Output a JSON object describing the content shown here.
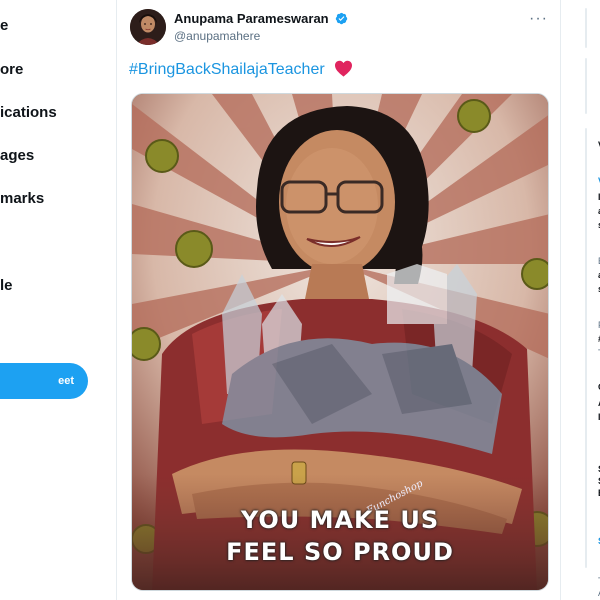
{
  "nav": {
    "items": [
      {
        "label": "e"
      },
      {
        "label": "ore"
      },
      {
        "label": "ications"
      },
      {
        "label": "ages"
      },
      {
        "label": "marks"
      },
      {
        "label": "le"
      }
    ],
    "tweet_button": "eet"
  },
  "tweet": {
    "author_name": "Anupama Parameswaran",
    "author_handle": "@anupamahere",
    "more_glyph": "···",
    "hashtag": "#BringBackShailajaTeacher",
    "image": {
      "caption_line1": "YOU MAKE US",
      "caption_line2": "FEEL SO PROUD",
      "signature": "Funchoshop"
    }
  },
  "right": {
    "fragments": [
      {
        "text": "V"
      },
      {
        "text": "V"
      },
      {
        "text": "Ir"
      },
      {
        "text": "a"
      },
      {
        "text": "s"
      },
      {
        "text": "E"
      },
      {
        "text": "a"
      },
      {
        "text": "s"
      },
      {
        "text": "P"
      },
      {
        "text": "#"
      },
      {
        "text": "T"
      },
      {
        "text": "C"
      },
      {
        "text": "A"
      },
      {
        "text": "I"
      },
      {
        "text": "S"
      },
      {
        "text": "S"
      },
      {
        "text": "B"
      },
      {
        "text": "S"
      },
      {
        "text": "T"
      },
      {
        "text": "A"
      }
    ]
  },
  "colors": {
    "accent": "#1da1f2",
    "link": "#1b95e0",
    "heart": "#e0245e",
    "border": "#e6ecf0"
  },
  "icons": [
    "verified-badge-icon",
    "red-heart-emoji-icon",
    "more-options-icon"
  ]
}
